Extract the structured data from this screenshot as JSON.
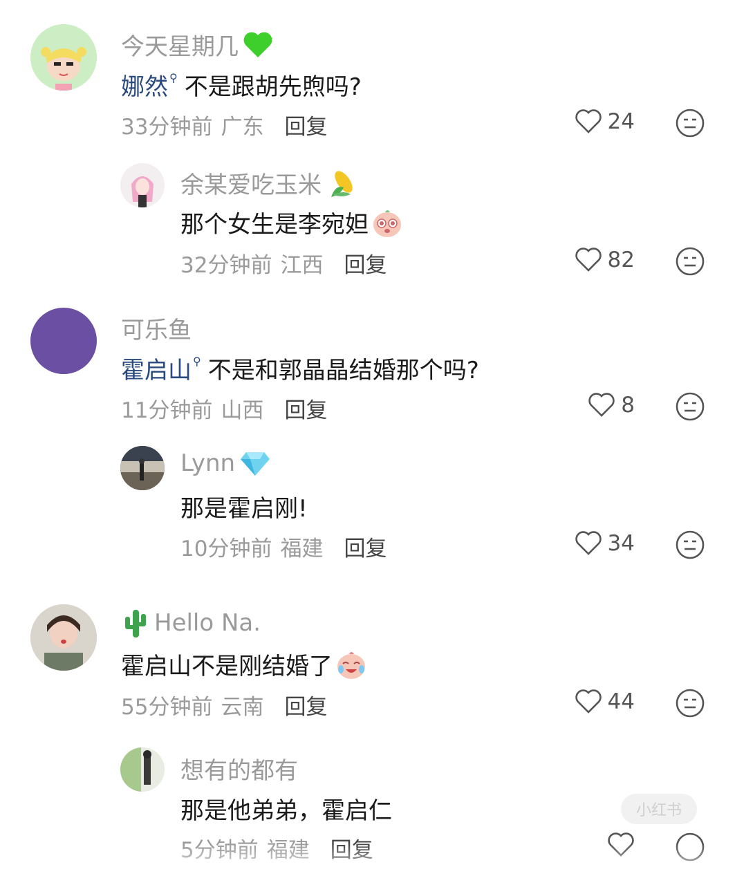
{
  "comments": [
    {
      "user": "今天星期几",
      "badge": "green-heart",
      "mention": "娜然",
      "text": "不是跟胡先煦吗?",
      "time": "33分钟前",
      "location": "广东",
      "reply": "回复",
      "likes": "24"
    },
    {
      "user": "余某爱吃玉米",
      "badge": "corn-emoji",
      "text": "那个女生是李宛妲",
      "time": "32分钟前",
      "location": "江西",
      "reply": "回复",
      "likes": "82"
    },
    {
      "user": "可乐鱼",
      "mention": "霍启山",
      "text": "不是和郭晶晶结婚那个吗?",
      "time": "11分钟前",
      "location": "山西",
      "reply": "回复",
      "likes": "8"
    },
    {
      "user": "Lynn",
      "badge": "diamond-emoji",
      "text": "那是霍启刚!",
      "time": "10分钟前",
      "location": "福建",
      "reply": "回复",
      "likes": "34"
    },
    {
      "user": "Hello Na.",
      "prefix_badge": "cactus-emoji",
      "text": "霍启山不是刚结婚了",
      "time": "55分钟前",
      "location": "云南",
      "reply": "回复",
      "likes": "44"
    },
    {
      "user": "想有的都有",
      "text": "那是他弟弟，霍启仁",
      "time": "5分钟前",
      "location": "福建",
      "reply": "回复"
    }
  ],
  "watermark": "小红书",
  "colors": {
    "mention": "#2a4a7f",
    "meta": "#9a9a9a",
    "text": "#1a1a1a"
  }
}
